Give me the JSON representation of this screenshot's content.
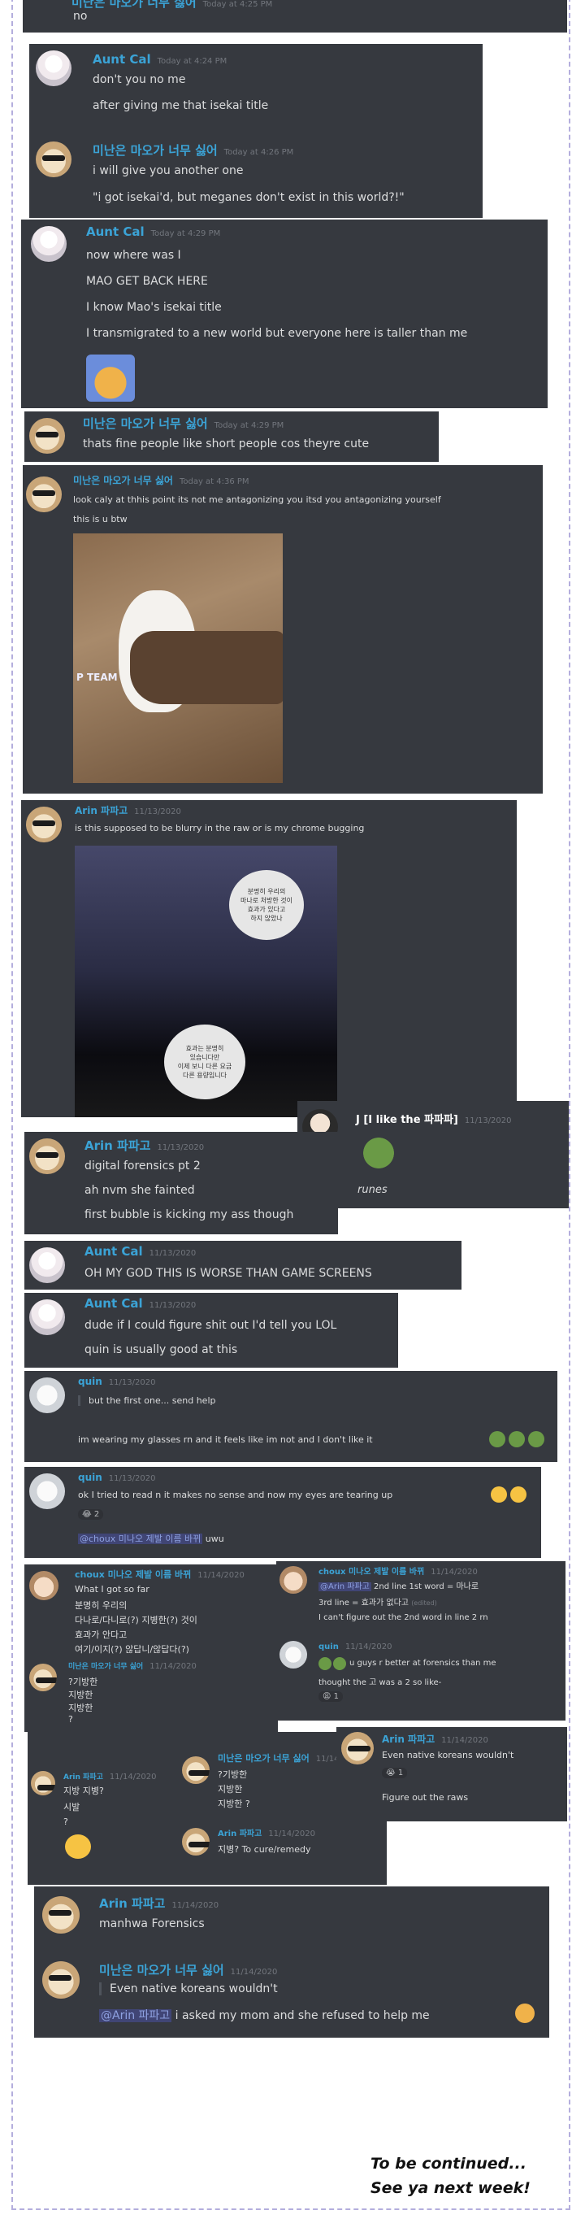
{
  "msg0": {
    "name": "미난은 마오가 너무 싫어",
    "ts": "Today at 4:25 PM",
    "text": "no"
  },
  "msg1": {
    "name": "Aunt Cal",
    "ts": "Today at 4:24 PM",
    "lines": [
      "don't you no me",
      "after giving me that isekai title"
    ],
    "reply_name": "미난은 마오가 너무 싫어",
    "reply_ts": "Today at 4:26 PM",
    "reply_lines": [
      "i will give you another one",
      "\"i got isekai'd, but meganes don't exist in this world?!\""
    ]
  },
  "msg2": {
    "name": "Aunt Cal",
    "ts": "Today at 4:29 PM",
    "lines": [
      "now where was I",
      "MAO GET BACK HERE",
      "I know Mao's isekai title",
      "I transmigrated to a new world but everyone here is taller than me"
    ]
  },
  "msg3": {
    "name": "미난은 마오가 너무 싫어",
    "ts": "Today at 4:29 PM",
    "text": "thats fine people like short people cos theyre cute"
  },
  "msg4": {
    "name": "미난은 마오가 너무 싫어",
    "ts": "Today at 4:36 PM",
    "lines": [
      "look caly at thhis point its not me antagonizing you itsd you antagonizing yourself",
      "this is u btw"
    ],
    "image_text": "P TEAM"
  },
  "msg5": {
    "name": "Arin 파파고",
    "ts": "11/13/2020",
    "text": "is this supposed to be blurry in the raw or is my chrome bugging",
    "bubble1": "분명히 우리의\n마나로 처방한 것이\n효과가 있다고\n하지 않았나",
    "bubble2": "효과는 분명히\n있습니다만\n이제 보니 다른 요금\n다른 용량입니다"
  },
  "msg6": {
    "name": "J [I like the 파파파]",
    "ts": "11/13/2020",
    "caption": "runes"
  },
  "msg7": {
    "name": "Arin 파파고",
    "ts": "11/13/2020",
    "lines": [
      "digital forensics pt 2",
      "ah nvm she fainted",
      "first bubble is kicking my ass though"
    ]
  },
  "msg8": {
    "name": "Aunt Cal",
    "ts": "11/13/2020",
    "text": "OH MY GOD THIS IS WORSE THAN GAME SCREENS"
  },
  "msg9": {
    "name": "Aunt Cal",
    "ts": "11/13/2020",
    "lines": [
      "dude if I could figure shit out I'd tell you LOL",
      "quin is usually good at this"
    ]
  },
  "msg10": {
    "name": "quin",
    "ts": "11/13/2020",
    "quote": "but the first one... send help",
    "text": "im wearing my glasses rn and it feels like im not and I don't like it"
  },
  "msg11": {
    "name": "quin",
    "ts": "11/13/2020",
    "text": "ok I tried to read n it makes no sense and now my eyes are tearing up",
    "reaction": "2",
    "mention": "@choux 미나오 제발 이름 바뀌",
    "after": "uwu"
  },
  "msg12": {
    "name": "choux 미나오 제발 이름 바뀌",
    "ts": "11/14/2020",
    "lines": [
      "What I got so far",
      "분명히 우리의",
      "다나로/다니로(?) 지병한(?) 것이",
      "효과가 안다고",
      "여기/이지(?) 않답니/않답다(?)"
    ],
    "sub_name": "미난은 마오가 너무 싫어",
    "sub_ts": "11/14/2020",
    "sub_lines": [
      "?기방한",
      "지방한",
      "지방한",
      "?"
    ]
  },
  "msg13": {
    "name": "choux 미나오 제발 이름 바뀌",
    "ts": "11/14/2020",
    "mention": "@Arin 파파고",
    "lines": [
      "2nd line 1st word = 마나로",
      "3rd line = 효과가 없다고",
      "I can't figure out the 2nd word in line 2 rn"
    ],
    "edited": "(edited)",
    "sub_name": "quin",
    "sub_ts": "11/14/2020",
    "sub_lines": [
      "u guys r better at forensics than me",
      "thought the 고 was a 2 so like-"
    ],
    "reaction": "1"
  },
  "msg14": {
    "name": "Arin 파파고",
    "ts": "11/14/2020",
    "lines": [
      "지방 지병?",
      "시발",
      "?"
    ],
    "mid_name": "미난은 마오가 너무 싫어",
    "mid_ts": "11/14/2020",
    "mid_lines": [
      "?기방한",
      "지방한",
      "지방한 ?"
    ],
    "low_name": "Arin 파파고",
    "low_ts": "11/14/2020",
    "low_text": "지병? To cure/remedy"
  },
  "msg15": {
    "name": "Arin 파파고",
    "ts": "11/14/2020",
    "lines": [
      "Even native koreans wouldn't",
      "Figure out the raws"
    ],
    "reaction": "1"
  },
  "msg16": {
    "name": "Arin 파파고",
    "ts": "11/14/2020",
    "text": "manhwa Forensics",
    "reply_name": "미난은 마오가 너무 싫어",
    "reply_ts": "11/14/2020",
    "quote": "Even native koreans wouldn't",
    "mention": "@Arin 파파고",
    "reply_text": "i asked my mom and she refused to help me"
  },
  "ending": {
    "line1": "To be continued...",
    "line2": "See ya next week!"
  },
  "colors": {
    "card": "#36393f",
    "name": "#3ba3d6",
    "text": "#dcddde",
    "timestamp": "#72767d",
    "border": "#b4aedd"
  }
}
